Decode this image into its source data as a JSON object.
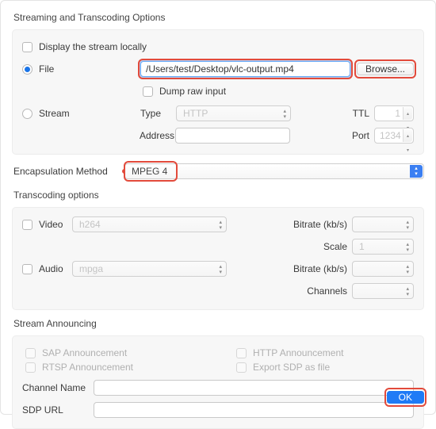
{
  "section_title": "Streaming and Transcoding Options",
  "output": {
    "display_locally_label": "Display the stream locally",
    "file_label": "File",
    "file_path": "/Users/test/Desktop/vlc-output.mp4",
    "browse_label": "Browse...",
    "dump_raw_label": "Dump raw input",
    "stream_label": "Stream",
    "type_label": "Type",
    "type_value": "HTTP",
    "ttl_label": "TTL",
    "ttl_value": "1",
    "address_label": "Address",
    "port_label": "Port",
    "port_value": "1234",
    "encaps_label": "Encapsulation Method",
    "encaps_value": "MPEG 4"
  },
  "transcoding": {
    "title": "Transcoding options",
    "video_label": "Video",
    "video_codec": "h264",
    "audio_label": "Audio",
    "audio_codec": "mpga",
    "bitrate_label": "Bitrate (kb/s)",
    "scale_label": "Scale",
    "scale_value": "1",
    "channels_label": "Channels"
  },
  "announcing": {
    "title": "Stream Announcing",
    "sap": "SAP Announcement",
    "rtsp": "RTSP Announcement",
    "http": "HTTP Announcement",
    "export_sdp": "Export SDP as file",
    "channel_name_label": "Channel Name",
    "sdp_url_label": "SDP URL"
  },
  "buttons": {
    "ok": "OK"
  }
}
